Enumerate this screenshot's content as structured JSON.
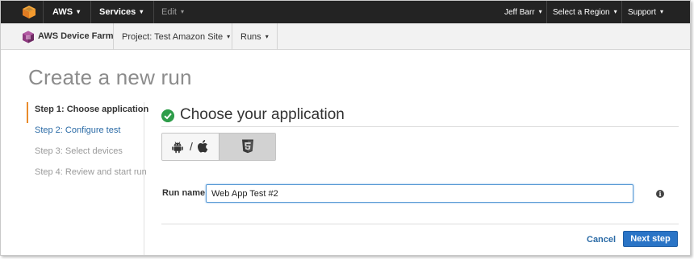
{
  "topnav": {
    "aws_label": "AWS",
    "services_label": "Services",
    "edit_label": "Edit",
    "user_label": "Jeff Barr",
    "region_label": "Select a Region",
    "support_label": "Support",
    "caret": "▾"
  },
  "servicebar": {
    "service_name": "AWS Device Farm",
    "project_prefix": "Project:",
    "project_name": "Test Amazon Site",
    "runs_label": "Runs",
    "caret": "▾"
  },
  "page": {
    "title": "Create a new run"
  },
  "steps": [
    {
      "label": "Step 1: Choose application"
    },
    {
      "label": "Step 2: Configure test"
    },
    {
      "label": "Step 3: Select devices"
    },
    {
      "label": "Step 4: Review and start run"
    }
  ],
  "main": {
    "section_title": "Choose your application",
    "toggle_separator": "/",
    "run_name_label": "Run name",
    "run_name_value": "Web App Test #2",
    "info_glyph": "i",
    "cancel_label": "Cancel",
    "next_label": "Next step"
  },
  "colors": {
    "accent_orange": "#e98b2c",
    "link_blue": "#2b6ba6",
    "primary_button": "#2a74c6",
    "success_green": "#2e9d4a"
  }
}
